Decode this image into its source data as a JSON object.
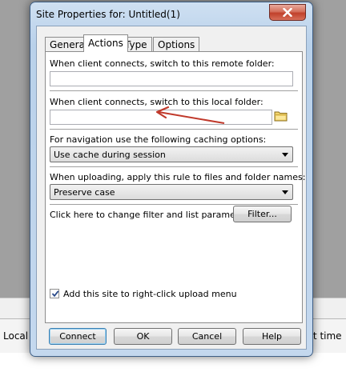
{
  "background": {
    "local_label": "Local",
    "time_label": "rt time"
  },
  "dialog": {
    "title": "Site Properties for: Untitled(1)",
    "tabs": [
      {
        "label": "General",
        "active": false
      },
      {
        "label": "Actions",
        "active": true
      },
      {
        "label": "Type",
        "active": false
      },
      {
        "label": "Options",
        "active": false
      }
    ],
    "remote_folder_label": "When client connects, switch to this remote folder:",
    "remote_folder_value": "",
    "local_folder_label": "When client connects, switch to this local folder:",
    "local_folder_value": "",
    "caching_label": "For navigation use the following caching options:",
    "caching_value": "Use cache during session",
    "upload_rule_label": "When uploading, apply this rule to files and folder names:",
    "upload_rule_value": "Preserve case",
    "filter_label": "Click here to change filter and list parameters:",
    "filter_button": "Filter...",
    "rightclick_label": "Add this site to right-click upload menu",
    "rightclick_checked": true,
    "buttons": {
      "connect": "Connect",
      "ok": "OK",
      "cancel": "Cancel",
      "help": "Help"
    },
    "annotation_arrow_color": "#c0392b"
  }
}
